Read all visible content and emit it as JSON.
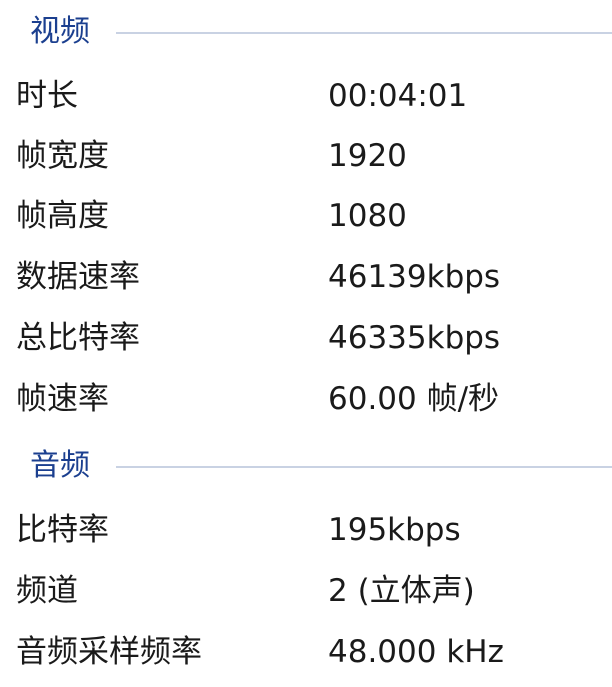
{
  "video": {
    "title": "视频",
    "rows": [
      {
        "label": "时长",
        "value": "00:04:01"
      },
      {
        "label": "帧宽度",
        "value": "1920"
      },
      {
        "label": "帧高度",
        "value": "1080"
      },
      {
        "label": "数据速率",
        "value": "46139kbps"
      },
      {
        "label": "总比特率",
        "value": "46335kbps"
      },
      {
        "label": "帧速率",
        "value": "60.00 帧/秒"
      }
    ]
  },
  "audio": {
    "title": "音频",
    "rows": [
      {
        "label": "比特率",
        "value": "195kbps"
      },
      {
        "label": "频道",
        "value": "2 (立体声)"
      },
      {
        "label": "音频采样频率",
        "value": "48.000 kHz"
      }
    ]
  },
  "colors": {
    "group_title": "#1b3f8f",
    "group_line": "#c9d2e3",
    "text": "#1a1a1a",
    "background": "#ffffff"
  }
}
